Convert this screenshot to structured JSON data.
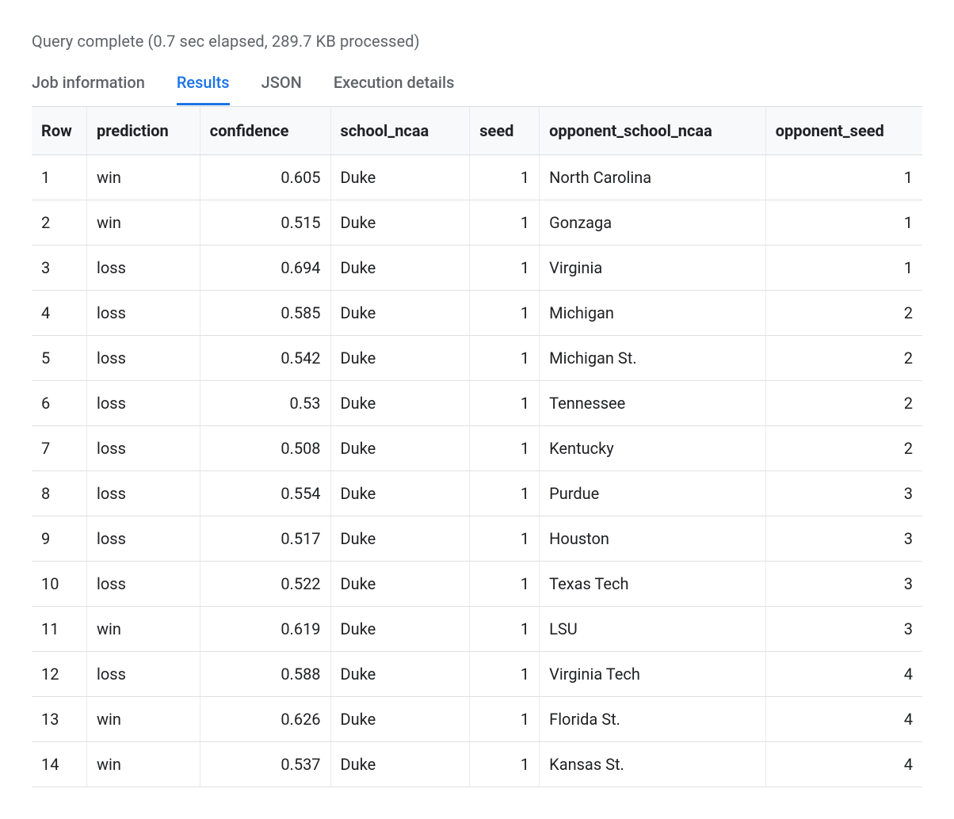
{
  "status": "Query complete (0.7 sec elapsed, 289.7 KB processed)",
  "tabs": {
    "job_info": "Job information",
    "results": "Results",
    "json": "JSON",
    "execution": "Execution details"
  },
  "table": {
    "columns": [
      "Row",
      "prediction",
      "confidence",
      "school_ncaa",
      "seed",
      "opponent_school_ncaa",
      "opponent_seed"
    ],
    "rows": [
      {
        "row": "1",
        "prediction": "win",
        "confidence": "0.605",
        "school_ncaa": "Duke",
        "seed": "1",
        "opponent_school_ncaa": "North Carolina",
        "opponent_seed": "1"
      },
      {
        "row": "2",
        "prediction": "win",
        "confidence": "0.515",
        "school_ncaa": "Duke",
        "seed": "1",
        "opponent_school_ncaa": "Gonzaga",
        "opponent_seed": "1"
      },
      {
        "row": "3",
        "prediction": "loss",
        "confidence": "0.694",
        "school_ncaa": "Duke",
        "seed": "1",
        "opponent_school_ncaa": "Virginia",
        "opponent_seed": "1"
      },
      {
        "row": "4",
        "prediction": "loss",
        "confidence": "0.585",
        "school_ncaa": "Duke",
        "seed": "1",
        "opponent_school_ncaa": "Michigan",
        "opponent_seed": "2"
      },
      {
        "row": "5",
        "prediction": "loss",
        "confidence": "0.542",
        "school_ncaa": "Duke",
        "seed": "1",
        "opponent_school_ncaa": "Michigan St.",
        "opponent_seed": "2"
      },
      {
        "row": "6",
        "prediction": "loss",
        "confidence": "0.53",
        "school_ncaa": "Duke",
        "seed": "1",
        "opponent_school_ncaa": "Tennessee",
        "opponent_seed": "2"
      },
      {
        "row": "7",
        "prediction": "loss",
        "confidence": "0.508",
        "school_ncaa": "Duke",
        "seed": "1",
        "opponent_school_ncaa": "Kentucky",
        "opponent_seed": "2"
      },
      {
        "row": "8",
        "prediction": "loss",
        "confidence": "0.554",
        "school_ncaa": "Duke",
        "seed": "1",
        "opponent_school_ncaa": "Purdue",
        "opponent_seed": "3"
      },
      {
        "row": "9",
        "prediction": "loss",
        "confidence": "0.517",
        "school_ncaa": "Duke",
        "seed": "1",
        "opponent_school_ncaa": "Houston",
        "opponent_seed": "3"
      },
      {
        "row": "10",
        "prediction": "loss",
        "confidence": "0.522",
        "school_ncaa": "Duke",
        "seed": "1",
        "opponent_school_ncaa": "Texas Tech",
        "opponent_seed": "3"
      },
      {
        "row": "11",
        "prediction": "win",
        "confidence": "0.619",
        "school_ncaa": "Duke",
        "seed": "1",
        "opponent_school_ncaa": "LSU",
        "opponent_seed": "3"
      },
      {
        "row": "12",
        "prediction": "loss",
        "confidence": "0.588",
        "school_ncaa": "Duke",
        "seed": "1",
        "opponent_school_ncaa": "Virginia Tech",
        "opponent_seed": "4"
      },
      {
        "row": "13",
        "prediction": "win",
        "confidence": "0.626",
        "school_ncaa": "Duke",
        "seed": "1",
        "opponent_school_ncaa": "Florida St.",
        "opponent_seed": "4"
      },
      {
        "row": "14",
        "prediction": "win",
        "confidence": "0.537",
        "school_ncaa": "Duke",
        "seed": "1",
        "opponent_school_ncaa": "Kansas St.",
        "opponent_seed": "4"
      }
    ]
  }
}
